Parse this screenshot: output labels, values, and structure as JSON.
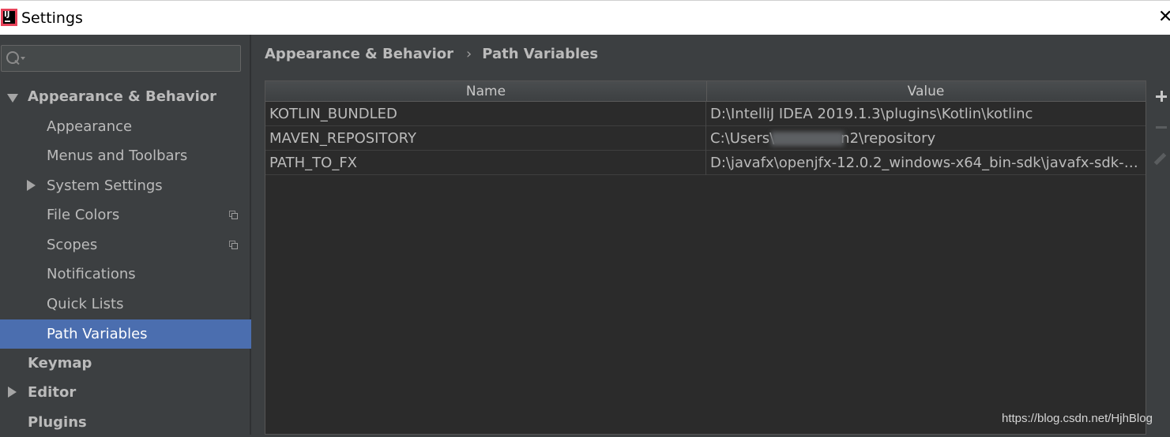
{
  "window": {
    "title": "Settings",
    "app_icon": "intellij-idea-icon",
    "close_icon": "close-icon"
  },
  "search": {
    "placeholder": "",
    "value": "",
    "icon": "search-icon"
  },
  "sidebar": {
    "items": [
      {
        "label": "Appearance & Behavior",
        "level": 0,
        "bold": true,
        "expanded": true
      },
      {
        "label": "Appearance",
        "level": 1
      },
      {
        "label": "Menus and Toolbars",
        "level": 1
      },
      {
        "label": "System Settings",
        "level": 1,
        "expandable": true
      },
      {
        "label": "File Colors",
        "level": 1,
        "project_icon": true
      },
      {
        "label": "Scopes",
        "level": 1,
        "project_icon": true
      },
      {
        "label": "Notifications",
        "level": 1
      },
      {
        "label": "Quick Lists",
        "level": 1
      },
      {
        "label": "Path Variables",
        "level": 1,
        "selected": true
      },
      {
        "label": "Keymap",
        "level": 0,
        "bold": true
      },
      {
        "label": "Editor",
        "level": 0,
        "bold": true,
        "expandable": true
      },
      {
        "label": "Plugins",
        "level": 0,
        "bold": true
      }
    ]
  },
  "breadcrumb": {
    "parent": "Appearance & Behavior",
    "separator": "›",
    "current": "Path Variables"
  },
  "table": {
    "columns": [
      "Name",
      "Value"
    ],
    "rows": [
      {
        "name": "KOTLIN_BUNDLED",
        "value": "D:\\IntelliJ IDEA 2019.1.3\\plugins\\Kotlin\\kotlinc"
      },
      {
        "name": "MAVEN_REPOSITORY",
        "value_prefix": "C:\\Users\\",
        "value_suffix": "n2\\repository",
        "redacted": true
      },
      {
        "name": "PATH_TO_FX",
        "value": "D:\\javafx\\openjfx-12.0.2_windows-x64_bin-sdk\\javafx-sdk-12.0..."
      }
    ]
  },
  "toolbar": {
    "add_icon": "plus-icon",
    "remove_icon": "minus-icon",
    "edit_icon": "pencil-icon"
  },
  "watermark": "https://blog.csdn.net/HjhBlog",
  "colors": {
    "background": "#3c3f41",
    "selection": "#4b6eaf",
    "table_background": "#2b2b2b",
    "text": "#bbbbbb"
  }
}
